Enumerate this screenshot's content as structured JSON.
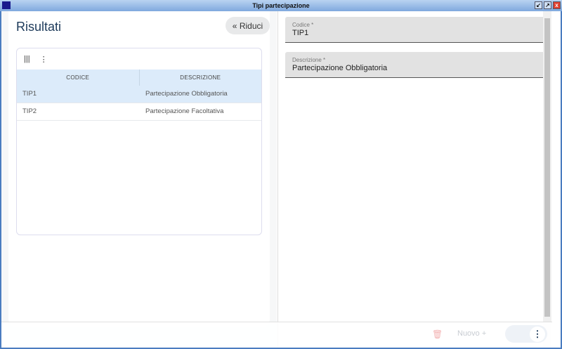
{
  "window": {
    "title": "Tipi partecipazione",
    "buttons": [
      "↙",
      "↗",
      "x"
    ]
  },
  "left": {
    "title": "Risultati",
    "collapse_label": "Riduci",
    "collapse_icon": "«",
    "toolbar": {
      "columns_icon": "|||",
      "menu_icon": "⋮"
    },
    "columns": [
      "CODICE",
      "DESCRIZIONE"
    ],
    "rows": [
      {
        "codice": "TIP1",
        "descrizione": "Partecipazione Obbligatoria"
      },
      {
        "codice": "TIP2",
        "descrizione": "Partecipazione Facoltativa"
      }
    ]
  },
  "form": {
    "codice": {
      "label": "Codice *",
      "value": "TIP1"
    },
    "descrizione": {
      "label": "Descrizione *",
      "value": "Partecipazione Obbligatoria"
    }
  },
  "footer": {
    "delete_icon": "🗑",
    "new_label": "Nuovo +",
    "more_icon": "⋮"
  }
}
